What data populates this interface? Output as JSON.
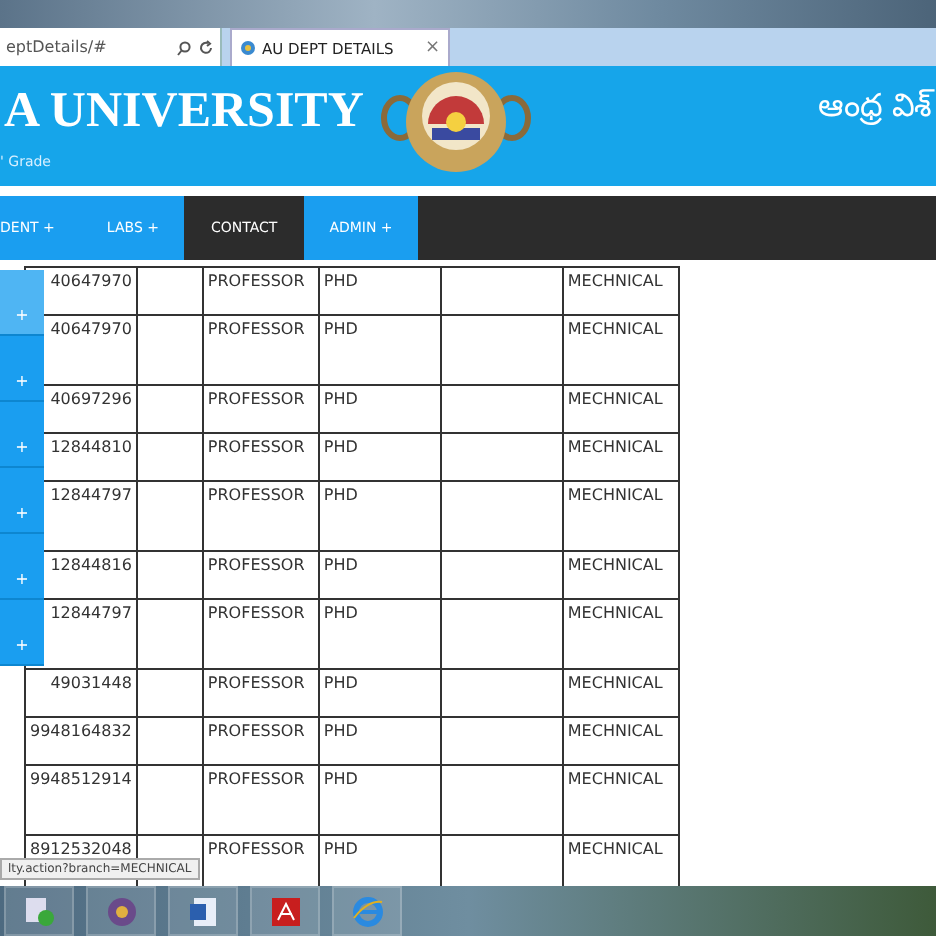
{
  "browser": {
    "address": "eptDetails/#",
    "tab": {
      "title": "AU DEPT DETAILS",
      "close": "×"
    }
  },
  "header": {
    "title": "A UNIVERSITY",
    "subtitle": "' Grade",
    "telugu": "ఆంధ్ర విశ్"
  },
  "nav": [
    {
      "label": "DENT +",
      "selected": false
    },
    {
      "label": "LABS +",
      "selected": false
    },
    {
      "label": "CONTACT",
      "selected": true
    },
    {
      "label": "ADMIN +",
      "selected": false
    }
  ],
  "submenu": [
    {
      "label": "+",
      "selected": true
    },
    {
      "label": "+",
      "selected": false
    },
    {
      "label": "+",
      "selected": false
    },
    {
      "label": "+",
      "selected": false
    },
    {
      "label": "+",
      "selected": false
    },
    {
      "label": "+",
      "selected": false
    }
  ],
  "table": {
    "rows": [
      {
        "tall": false,
        "cells": [
          "40647970",
          "",
          "PROFESSOR",
          "PHD",
          "",
          "MECHNICAL"
        ]
      },
      {
        "tall": true,
        "cells": [
          "40647970",
          "",
          "PROFESSOR",
          "PHD",
          "",
          "MECHNICAL"
        ]
      },
      {
        "tall": false,
        "cells": [
          "40697296",
          "",
          "PROFESSOR",
          "PHD",
          "",
          "MECHNICAL"
        ]
      },
      {
        "tall": false,
        "cells": [
          "12844810",
          "",
          "PROFESSOR",
          "PHD",
          "",
          "MECHNICAL"
        ]
      },
      {
        "tall": true,
        "cells": [
          "12844797",
          "",
          "PROFESSOR",
          "PHD",
          "",
          "MECHNICAL"
        ]
      },
      {
        "tall": false,
        "cells": [
          "12844816",
          "",
          "PROFESSOR",
          "PHD",
          "",
          "MECHNICAL"
        ]
      },
      {
        "tall": true,
        "cells": [
          "12844797",
          "",
          "PROFESSOR",
          "PHD",
          "",
          "MECHNICAL"
        ]
      },
      {
        "tall": false,
        "cells": [
          "49031448",
          "",
          "PROFESSOR",
          "PHD",
          "",
          "MECHNICAL"
        ]
      },
      {
        "tall": false,
        "cells": [
          "9948164832",
          "",
          "PROFESSOR",
          "PHD",
          "",
          "MECHNICAL"
        ]
      },
      {
        "tall": true,
        "cells": [
          "9948512914",
          "",
          "PROFESSOR",
          "PHD",
          "",
          "MECHNICAL"
        ]
      },
      {
        "tall": true,
        "cells": [
          "8912532048",
          "",
          "PROFESSOR",
          "PHD",
          "",
          "MECHNICAL"
        ]
      }
    ]
  },
  "status_url": "lty.action?branch=MECHNICAL"
}
